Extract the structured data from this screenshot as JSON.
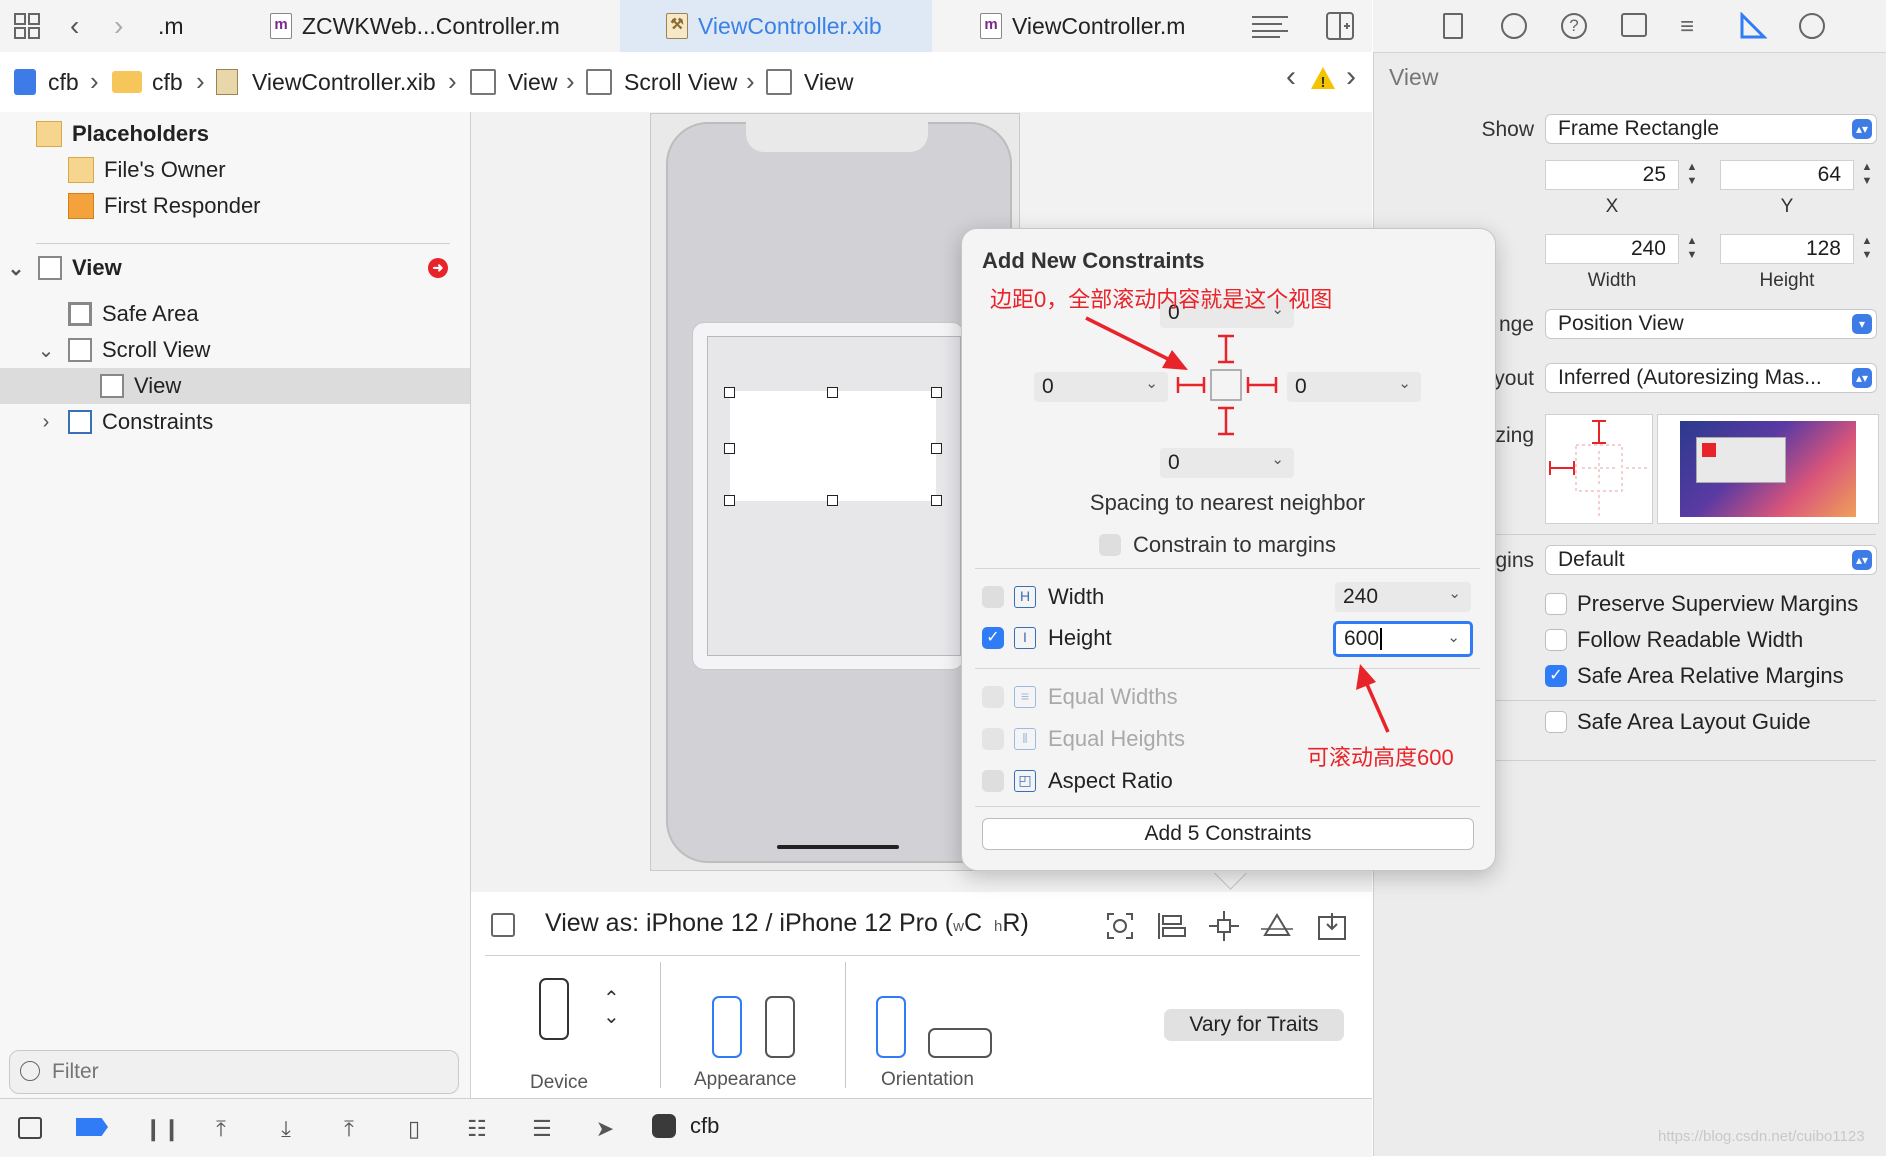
{
  "tabs": [
    {
      "label": ".m",
      "icon": "m-file-icon"
    },
    {
      "label": "ZCWKWeb...Controller.m",
      "icon": "m-file-icon"
    },
    {
      "label": "ViewController.xib",
      "icon": "xib-file-icon",
      "active": true
    },
    {
      "label": "ViewController.m",
      "icon": "m-file-icon"
    }
  ],
  "breadcrumbs": [
    "cfb",
    "cfb",
    "ViewController.xib",
    "View",
    "Scroll View",
    "View"
  ],
  "outline": {
    "placeholders": "Placeholders",
    "files_owner": "File's Owner",
    "first_responder": "First Responder",
    "view": "View",
    "safe_area": "Safe Area",
    "scroll_view": "Scroll View",
    "inner_view": "View",
    "constraints": "Constraints",
    "filter_placeholder": "Filter"
  },
  "canvas": {
    "view_as": "View as: iPhone 12 / iPhone 12 Pro (",
    "view_as_w": "w",
    "view_as_c": "C",
    "view_as_h": "h",
    "view_as_r": "R)",
    "device_label": "Device",
    "appearance_label": "Appearance",
    "orientation_label": "Orientation",
    "vary_button": "Vary for Traits"
  },
  "popover": {
    "title": "Add New Constraints",
    "top": "0",
    "left": "0",
    "right": "0",
    "bottom": "0",
    "spacing_label": "Spacing to nearest neighbor",
    "constrain_margins": "Constrain to margins",
    "width_label": "Width",
    "width_value": "240",
    "height_label": "Height",
    "height_value": "600",
    "equal_widths": "Equal Widths",
    "equal_heights": "Equal Heights",
    "aspect_ratio": "Aspect Ratio",
    "add_button": "Add 5 Constraints",
    "height_checked": true
  },
  "annotations": {
    "margins_note": "边距0，全部滚动内容就是这个视图",
    "height_note": "可滚动高度600"
  },
  "inspector": {
    "section": "View",
    "show_label": "Show",
    "show_value": "Frame Rectangle",
    "x": "25",
    "y": "64",
    "x_label": "X",
    "y_label": "Y",
    "width": "240",
    "height": "128",
    "width_label": "Width",
    "height_label": "Height",
    "arrange_label": "nge",
    "arrange_value": "Position View",
    "layout_label": "yout",
    "layout_value": "Inferred (Autoresizing Mas...",
    "sizing_label": "zing",
    "margins_label": "gins",
    "margins_value": "Default",
    "preserve": "Preserve Superview Margins",
    "readable": "Follow Readable Width",
    "safe_relative": "Safe Area Relative Margins",
    "safe_guide": "Safe Area Layout Guide"
  },
  "debug": {
    "scheme": "cfb"
  },
  "watermark": "https://blog.csdn.net/cuibo1123",
  "colors": {
    "accent": "#3d7ce6",
    "annotation": "#e8242a"
  }
}
